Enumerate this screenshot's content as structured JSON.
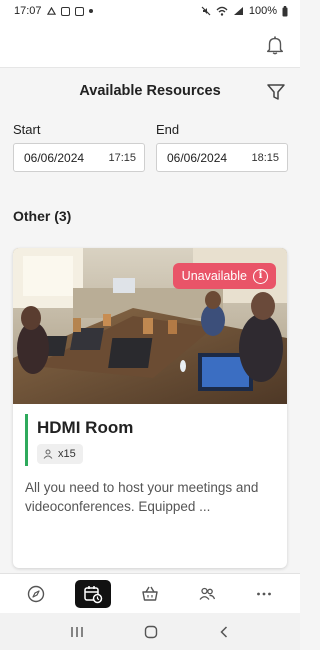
{
  "status_bar": {
    "time": "17:07",
    "battery": "100%",
    "icons": [
      "notification-icon",
      "gallery-icon",
      "calendar-status-icon",
      "mute-icon",
      "wifi-icon",
      "signal-icon",
      "battery-icon"
    ]
  },
  "header": {
    "bell_icon": "bell-icon"
  },
  "resources": {
    "title": "Available Resources",
    "filter_icon": "filter-icon"
  },
  "dates": {
    "start": {
      "label": "Start",
      "date": "06/06/2024",
      "time": "17:15"
    },
    "end": {
      "label": "End",
      "date": "06/06/2024",
      "time": "18:15"
    }
  },
  "category": {
    "title": "Other (3)"
  },
  "card": {
    "status": "Unavailable",
    "status_color": "#e95468",
    "name": "HDMI Room",
    "name_accent": "#2eaa5c",
    "capacity": "x15",
    "description": "All you need to host your meetings and videoconferences. Equipped ..."
  },
  "bottom_nav": {
    "items": [
      "compass-icon",
      "calendar-clock-icon",
      "basket-icon",
      "users-icon",
      "more-icon"
    ],
    "active": "calendar-clock-icon"
  },
  "system_nav": {
    "items": [
      "recent-apps-icon",
      "home-icon",
      "back-icon"
    ]
  }
}
